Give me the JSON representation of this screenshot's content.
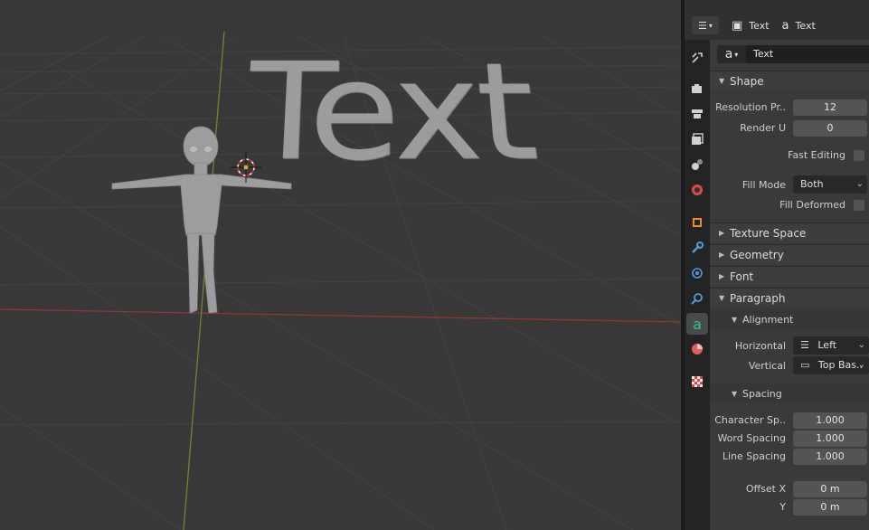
{
  "viewport": {
    "text_object": "Text"
  },
  "header": {
    "breadcrumb": [
      {
        "icon": "object-square-icon",
        "label": "Text"
      },
      {
        "icon": "font-a-icon",
        "label": "Text"
      }
    ]
  },
  "datablock": {
    "name": "Text"
  },
  "sections": {
    "shape": {
      "label": "Shape",
      "resolution_preview_label": "Resolution Pr..",
      "resolution_preview_value": "12",
      "render_u_label": "Render U",
      "render_u_value": "0",
      "fast_editing_label": "Fast Editing",
      "fill_mode_label": "Fill Mode",
      "fill_mode_value": "Both",
      "fill_deformed_label": "Fill Deformed"
    },
    "texture_space": {
      "label": "Texture Space"
    },
    "geometry": {
      "label": "Geometry"
    },
    "font": {
      "label": "Font"
    },
    "paragraph": {
      "label": "Paragraph",
      "alignment": {
        "label": "Alignment",
        "horizontal_label": "Horizontal",
        "horizontal_value": "Left",
        "vertical_label": "Vertical",
        "vertical_value": "Top Bas.."
      },
      "spacing": {
        "label": "Spacing",
        "character_label": "Character Sp..",
        "character_value": "1.000",
        "word_label": "Word Spacing",
        "word_value": "1.000",
        "line_label": "Line Spacing",
        "line_value": "1.000",
        "offset_x_label": "Offset X",
        "offset_x_value": "0 m",
        "offset_y_label": "Y",
        "offset_y_value": "0 m"
      }
    }
  },
  "tabs": [
    {
      "name": "tool-icon",
      "color": "#d0d0d0"
    },
    {
      "name": "render-icon",
      "color": "#d0d0d0"
    },
    {
      "name": "output-icon",
      "color": "#d0d0d0"
    },
    {
      "name": "view-layer-icon",
      "color": "#d0d0d0"
    },
    {
      "name": "scene-icon",
      "color": "#d0d0d0"
    },
    {
      "name": "world-icon",
      "color": "#e04848"
    },
    {
      "name": "object-icon",
      "color": "#f08a30"
    },
    {
      "name": "modifier-icon",
      "color": "#5a9ad8"
    },
    {
      "name": "particles-icon",
      "color": "#5a9ad8"
    },
    {
      "name": "physics-icon",
      "color": "#5a9ad8"
    },
    {
      "name": "font-data-icon",
      "color": "#39c39a"
    },
    {
      "name": "material-icon",
      "color": "#e06060"
    },
    {
      "name": "texture-icon",
      "color": "#d84848"
    }
  ]
}
